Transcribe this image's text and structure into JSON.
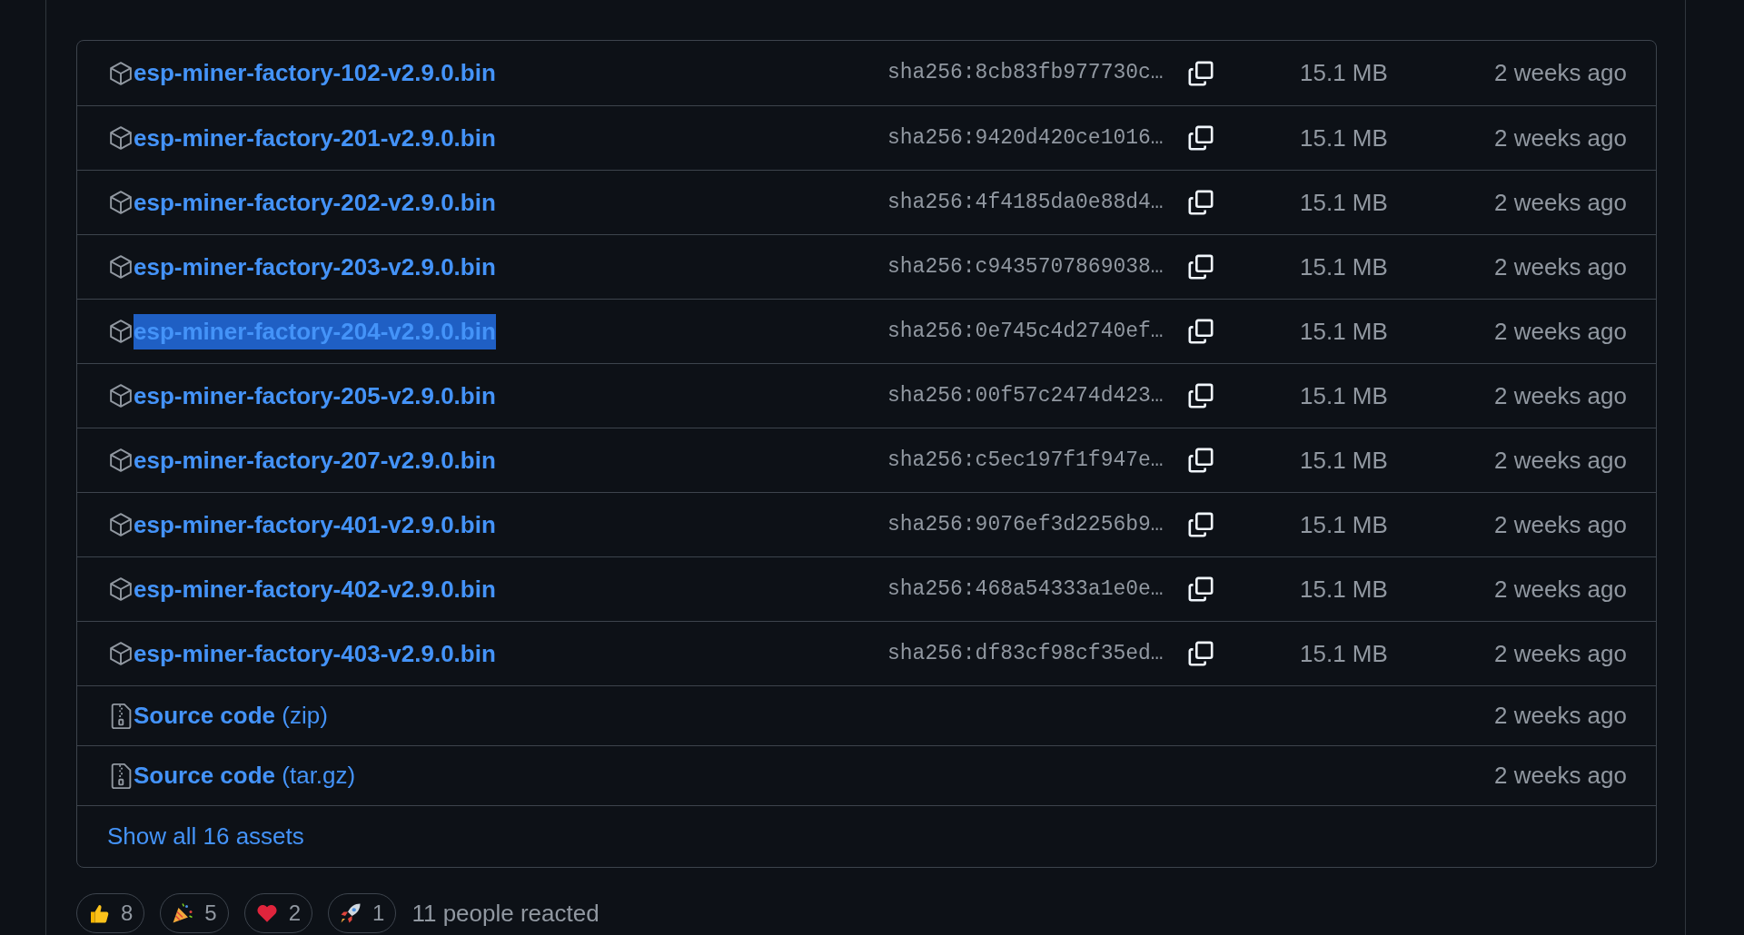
{
  "assets": [
    {
      "kind": "binary",
      "name": "esp-miner-factory-102-v2.9.0.bin",
      "highlighted": false,
      "digest": "sha256:8cb83fb977730c…",
      "size": "15.1 MB",
      "date": "2 weeks ago"
    },
    {
      "kind": "binary",
      "name": "esp-miner-factory-201-v2.9.0.bin",
      "highlighted": false,
      "digest": "sha256:9420d420ce1016…",
      "size": "15.1 MB",
      "date": "2 weeks ago"
    },
    {
      "kind": "binary",
      "name": "esp-miner-factory-202-v2.9.0.bin",
      "highlighted": false,
      "digest": "sha256:4f4185da0e88d4…",
      "size": "15.1 MB",
      "date": "2 weeks ago"
    },
    {
      "kind": "binary",
      "name": "esp-miner-factory-203-v2.9.0.bin",
      "highlighted": false,
      "digest": "sha256:c9435707869038…",
      "size": "15.1 MB",
      "date": "2 weeks ago"
    },
    {
      "kind": "binary",
      "name": "esp-miner-factory-204-v2.9.0.bin",
      "highlighted": true,
      "digest": "sha256:0e745c4d2740ef…",
      "size": "15.1 MB",
      "date": "2 weeks ago"
    },
    {
      "kind": "binary",
      "name": "esp-miner-factory-205-v2.9.0.bin",
      "highlighted": false,
      "digest": "sha256:00f57c2474d423…",
      "size": "15.1 MB",
      "date": "2 weeks ago"
    },
    {
      "kind": "binary",
      "name": "esp-miner-factory-207-v2.9.0.bin",
      "highlighted": false,
      "digest": "sha256:c5ec197f1f947e…",
      "size": "15.1 MB",
      "date": "2 weeks ago"
    },
    {
      "kind": "binary",
      "name": "esp-miner-factory-401-v2.9.0.bin",
      "highlighted": false,
      "digest": "sha256:9076ef3d2256b9…",
      "size": "15.1 MB",
      "date": "2 weeks ago"
    },
    {
      "kind": "binary",
      "name": "esp-miner-factory-402-v2.9.0.bin",
      "highlighted": false,
      "digest": "sha256:468a54333a1e0e…",
      "size": "15.1 MB",
      "date": "2 weeks ago"
    },
    {
      "kind": "binary",
      "name": "esp-miner-factory-403-v2.9.0.bin",
      "highlighted": false,
      "digest": "sha256:df83cf98cf35ed…",
      "size": "15.1 MB",
      "date": "2 weeks ago"
    },
    {
      "kind": "source",
      "name": "Source code",
      "format": "(zip)",
      "date": "2 weeks ago"
    },
    {
      "kind": "source",
      "name": "Source code",
      "format": "(tar.gz)",
      "date": "2 weeks ago"
    }
  ],
  "show_all": "Show all 16 assets",
  "reactions": [
    {
      "kind": "thumbs_up",
      "count": "8"
    },
    {
      "kind": "party",
      "count": "5"
    },
    {
      "kind": "heart",
      "count": "2"
    },
    {
      "kind": "rocket",
      "count": "1"
    }
  ],
  "reaction_summary": "11 people reacted"
}
